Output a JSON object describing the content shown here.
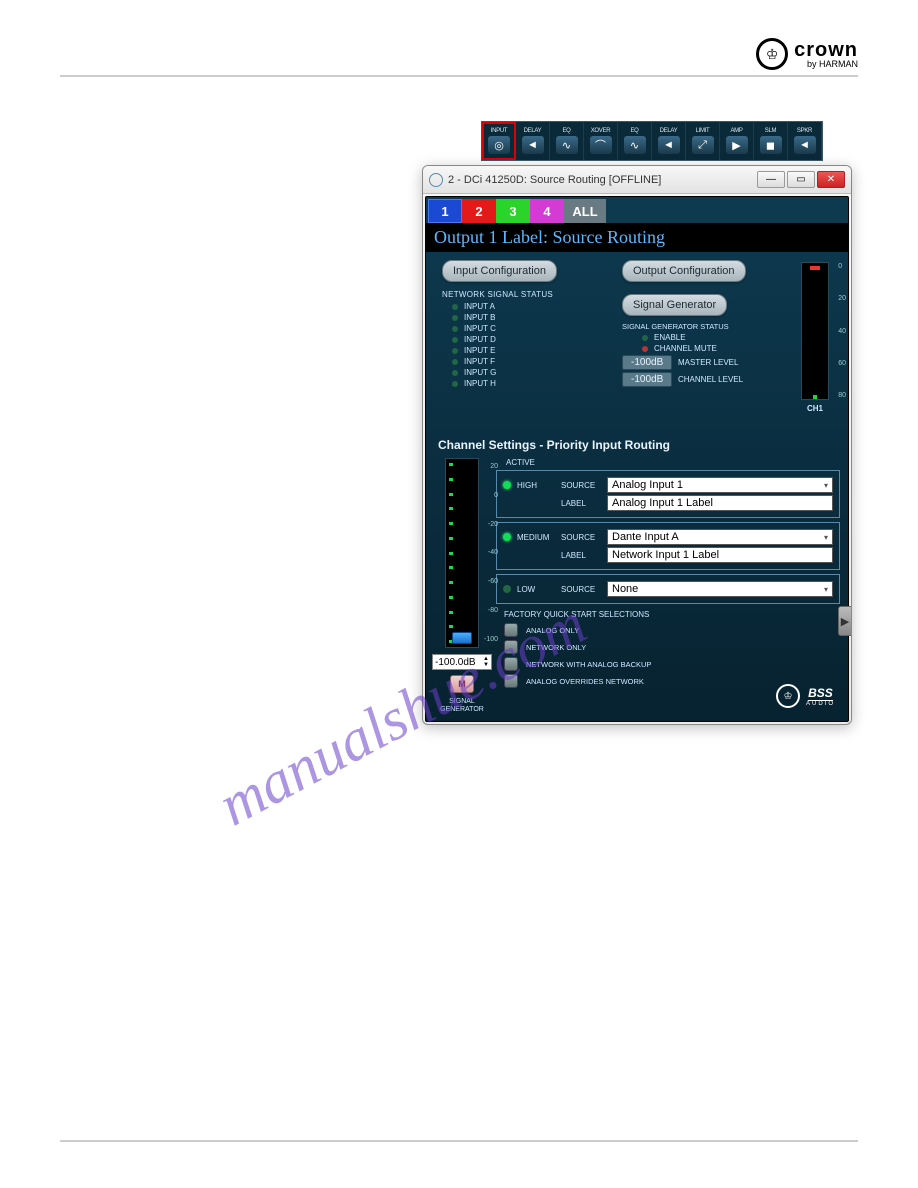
{
  "logo": {
    "brand": "crown",
    "sub": "by HARMAN",
    "glyph": "♔"
  },
  "watermark": "manualshue.com",
  "toolbar": [
    {
      "label": "INPUT",
      "glyph": "◎"
    },
    {
      "label": "DELAY",
      "glyph": "◄"
    },
    {
      "label": "EQ",
      "glyph": "∿"
    },
    {
      "label": "XOVER",
      "glyph": "⌒"
    },
    {
      "label": "EQ",
      "glyph": "∿"
    },
    {
      "label": "DELAY",
      "glyph": "◄"
    },
    {
      "label": "LIMIT",
      "glyph": "⤢"
    },
    {
      "label": "AMP",
      "glyph": "▶"
    },
    {
      "label": "SLM",
      "glyph": "◼"
    },
    {
      "label": "SPKR",
      "glyph": "◄"
    }
  ],
  "window": {
    "title": "2 - DCi 41250D: Source Routing [OFFLINE]",
    "minimize": "—",
    "maximize": "▭",
    "close": "✕"
  },
  "ch_tabs": [
    "1",
    "2",
    "3",
    "4",
    "ALL"
  ],
  "output_label": "Output 1 Label: Source Routing",
  "buttons": {
    "input_config": "Input Configuration",
    "output_config": "Output Configuration",
    "signal_gen": "Signal Generator"
  },
  "network_status": {
    "title": "NETWORK SIGNAL STATUS",
    "items": [
      "INPUT A",
      "INPUT B",
      "INPUT C",
      "INPUT D",
      "INPUT E",
      "INPUT F",
      "INPUT G",
      "INPUT H"
    ]
  },
  "sig_gen_status": {
    "title": "SIGNAL GENERATOR STATUS",
    "enable": "ENABLE",
    "mute": "CHANNEL MUTE",
    "master_val": "-100dB",
    "master_lbl": "MASTER LEVEL",
    "channel_val": "-100dB",
    "channel_lbl": "CHANNEL LEVEL"
  },
  "meter": {
    "ticks": [
      "0",
      "20",
      "40",
      "60",
      "80"
    ],
    "name": "CH1"
  },
  "section_title": "Channel Settings - Priority Input Routing",
  "fader": {
    "ticks": [
      "20",
      "0",
      "-20",
      "-40",
      "-60",
      "-80",
      "-100"
    ],
    "db_value": "-100.0dB",
    "m_label": "M",
    "sg_label": "SIGNAL\nGENERATOR"
  },
  "priority": {
    "active": "ACTIVE",
    "rows": [
      {
        "name": "HIGH",
        "source_lbl": "SOURCE",
        "source": "Analog Input 1",
        "label_lbl": "LABEL",
        "label": "Analog Input 1 Label",
        "on": true
      },
      {
        "name": "MEDIUM",
        "source_lbl": "SOURCE",
        "source": "Dante Input A",
        "label_lbl": "LABEL",
        "label": "Network Input 1 Label",
        "on": true
      },
      {
        "name": "LOW",
        "source_lbl": "SOURCE",
        "source": "None",
        "on": false
      }
    ],
    "factory_title": "FACTORY QUICK START SELECTIONS",
    "factory": [
      "ANALOG ONLY",
      "NETWORK ONLY",
      "NETWORK WITH ANALOG BACKUP",
      "ANALOG OVERRIDES NETWORK"
    ]
  },
  "footer_logos": {
    "crown": "♔",
    "bss": "BSS",
    "bss_sub": "AUDIO"
  },
  "side_arrow": "▶"
}
